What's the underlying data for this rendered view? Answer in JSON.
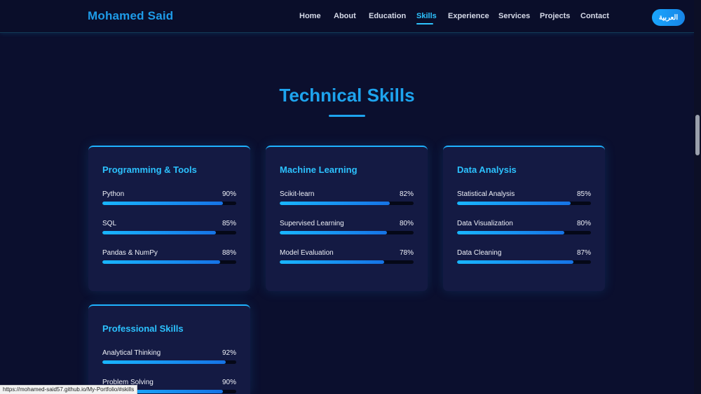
{
  "navbar": {
    "brand": "Mohamed Said",
    "links": [
      "Home",
      "About",
      "Education",
      "Skills",
      "Experience",
      "Services",
      "Projects",
      "Contact"
    ],
    "active": "Skills",
    "lang_button": "العربية"
  },
  "section": {
    "title": "Technical Skills"
  },
  "cards": [
    {
      "title": "Programming & Tools",
      "skills": [
        {
          "name": "Python",
          "percent_label": "90%",
          "level": 90
        },
        {
          "name": "SQL",
          "percent_label": "85%",
          "level": 85
        },
        {
          "name": "Pandas & NumPy",
          "percent_label": "88%",
          "level": 88
        }
      ]
    },
    {
      "title": "Machine Learning",
      "skills": [
        {
          "name": "Scikit-learn",
          "percent_label": "82%",
          "level": 82
        },
        {
          "name": "Supervised Learning",
          "percent_label": "80%",
          "level": 80
        },
        {
          "name": "Model Evaluation",
          "percent_label": "78%",
          "level": 78
        }
      ]
    },
    {
      "title": "Data Analysis",
      "skills": [
        {
          "name": "Statistical Analysis",
          "percent_label": "85%",
          "level": 85
        },
        {
          "name": "Data Visualization",
          "percent_label": "80%",
          "level": 80
        },
        {
          "name": "Data Cleaning",
          "percent_label": "87%",
          "level": 87
        }
      ]
    },
    {
      "title": "Professional Skills",
      "skills": [
        {
          "name": "Analytical Thinking",
          "percent_label": "92%",
          "level": 92
        },
        {
          "name": "Problem Solving",
          "percent_label": "90%",
          "level": 90
        }
      ]
    }
  ],
  "status_bar": {
    "url": "https://mohamed-said57.github.io/My-Portfolio/#skills"
  },
  "colors": {
    "background": "#0b0f2e",
    "card": "#141a43",
    "accent": "#1ea4ee",
    "card_title": "#2cc2ff"
  }
}
